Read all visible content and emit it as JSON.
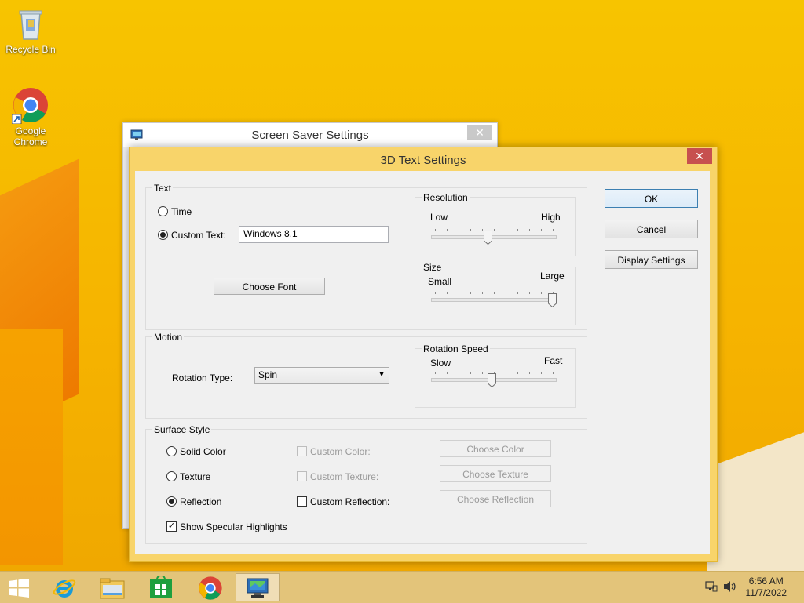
{
  "desktop": {
    "icons": [
      {
        "label": "Recycle Bin"
      },
      {
        "label": "Google Chrome"
      }
    ]
  },
  "screensaver_window": {
    "title": "Screen Saver Settings",
    "close_glyph": "✕"
  },
  "text3d_window": {
    "title": "3D Text Settings",
    "close_glyph": "✕",
    "text_group": {
      "label": "Text",
      "time_label": "Time",
      "custom_text_label": "Custom Text:",
      "custom_text_value": "Windows 8.1",
      "choose_font_label": "Choose Font",
      "selected": "custom_text"
    },
    "resolution": {
      "label": "Resolution",
      "low": "Low",
      "high": "High",
      "value": 0.45
    },
    "size": {
      "label": "Size",
      "small": "Small",
      "large": "Large",
      "value": 1.0
    },
    "motion_group": {
      "label": "Motion",
      "rotation_type_label": "Rotation Type:",
      "rotation_type_value": "Spin"
    },
    "rotation_speed": {
      "label": "Rotation Speed",
      "slow": "Slow",
      "fast": "Fast",
      "value": 0.48
    },
    "surface_group": {
      "label": "Surface Style",
      "solid_color_label": "Solid Color",
      "texture_label": "Texture",
      "reflection_label": "Reflection",
      "selected": "reflection",
      "custom_color_label": "Custom Color:",
      "custom_texture_label": "Custom Texture:",
      "custom_reflection_label": "Custom Reflection:",
      "choose_color_label": "Choose Color",
      "choose_texture_label": "Choose Texture",
      "choose_reflection_label": "Choose Reflection",
      "show_specular_label": "Show Specular Highlights",
      "show_specular_checked": true
    },
    "buttons": {
      "ok": "OK",
      "cancel": "Cancel",
      "display_settings": "Display Settings"
    }
  },
  "taskbar": {
    "items": [
      "start-icon",
      "internet-explorer-icon",
      "file-explorer-icon",
      "store-icon",
      "chrome-icon",
      "screensaver-settings-icon"
    ],
    "time": "6:56 AM",
    "date": "11/7/2022"
  },
  "colors": {
    "desktop_bg": "#f5b800",
    "active_frame": "#f8d46a",
    "close_red": "#c7504f"
  }
}
